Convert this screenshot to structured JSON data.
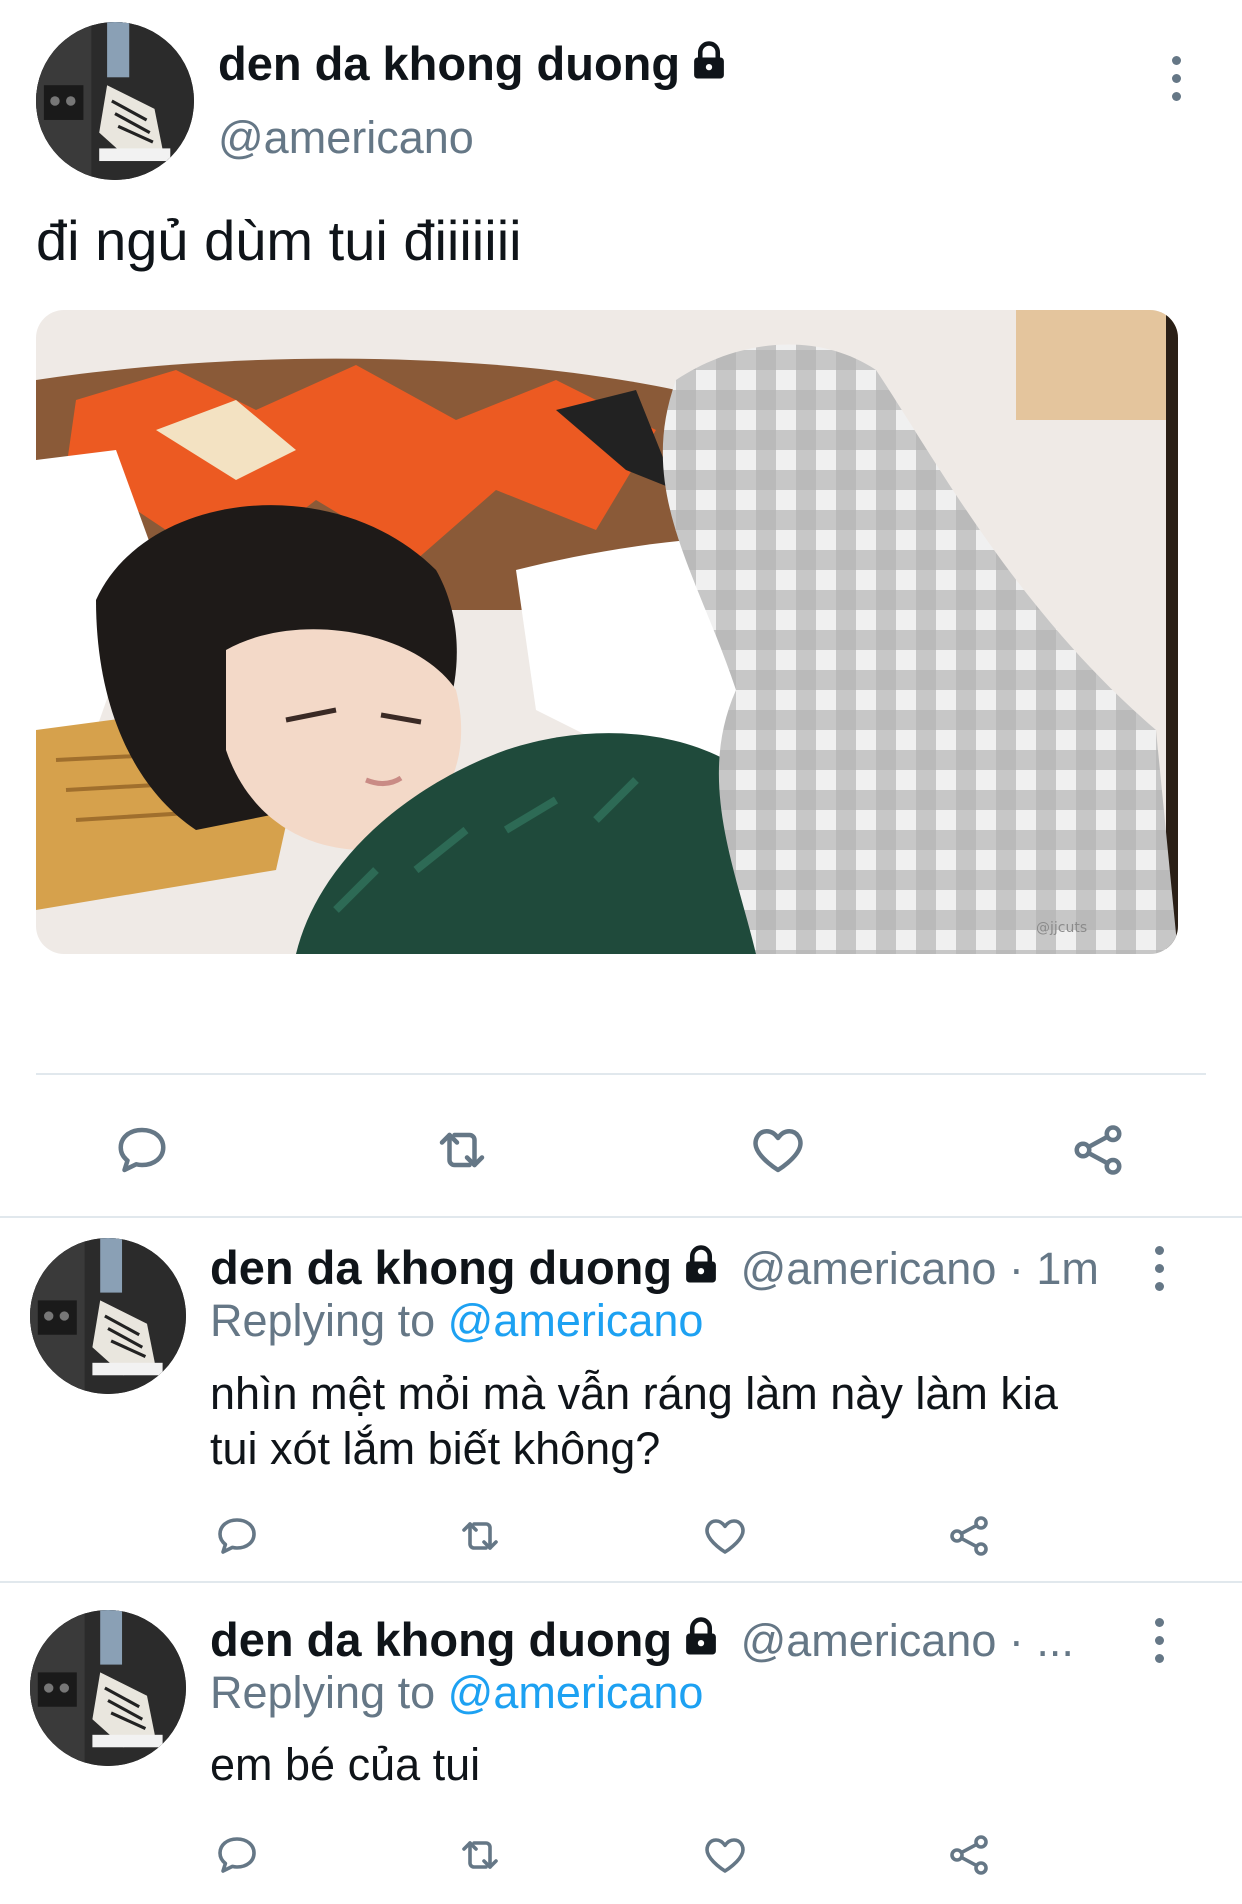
{
  "main_tweet": {
    "display_name": "den da khong duong",
    "handle": "@americano",
    "text": "đi ngủ dùm tui điiiiiii",
    "media_watermark": "@jjcuts",
    "actions": [
      "reply-icon",
      "retweet-icon",
      "like-icon",
      "share-icon"
    ]
  },
  "replies": [
    {
      "display_name": "den da khong duong",
      "handle_time": "@americano · 1m",
      "replying_prefix": "Replying to ",
      "replying_to": "@americano",
      "text_lines": [
        "nhìn mệt mỏi mà vẫn ráng làm này làm kia",
        "tui xót lắm biết không?"
      ]
    },
    {
      "display_name": "den da khong duong",
      "handle_time": "@americano · ...",
      "replying_prefix": "Replying to ",
      "replying_to": "@americano",
      "text_lines": [
        "em bé của tui"
      ]
    }
  ],
  "colors": {
    "text": "#0f1419",
    "secondary": "#657786",
    "link": "#1da1f2",
    "divider": "#e1e8ed"
  }
}
